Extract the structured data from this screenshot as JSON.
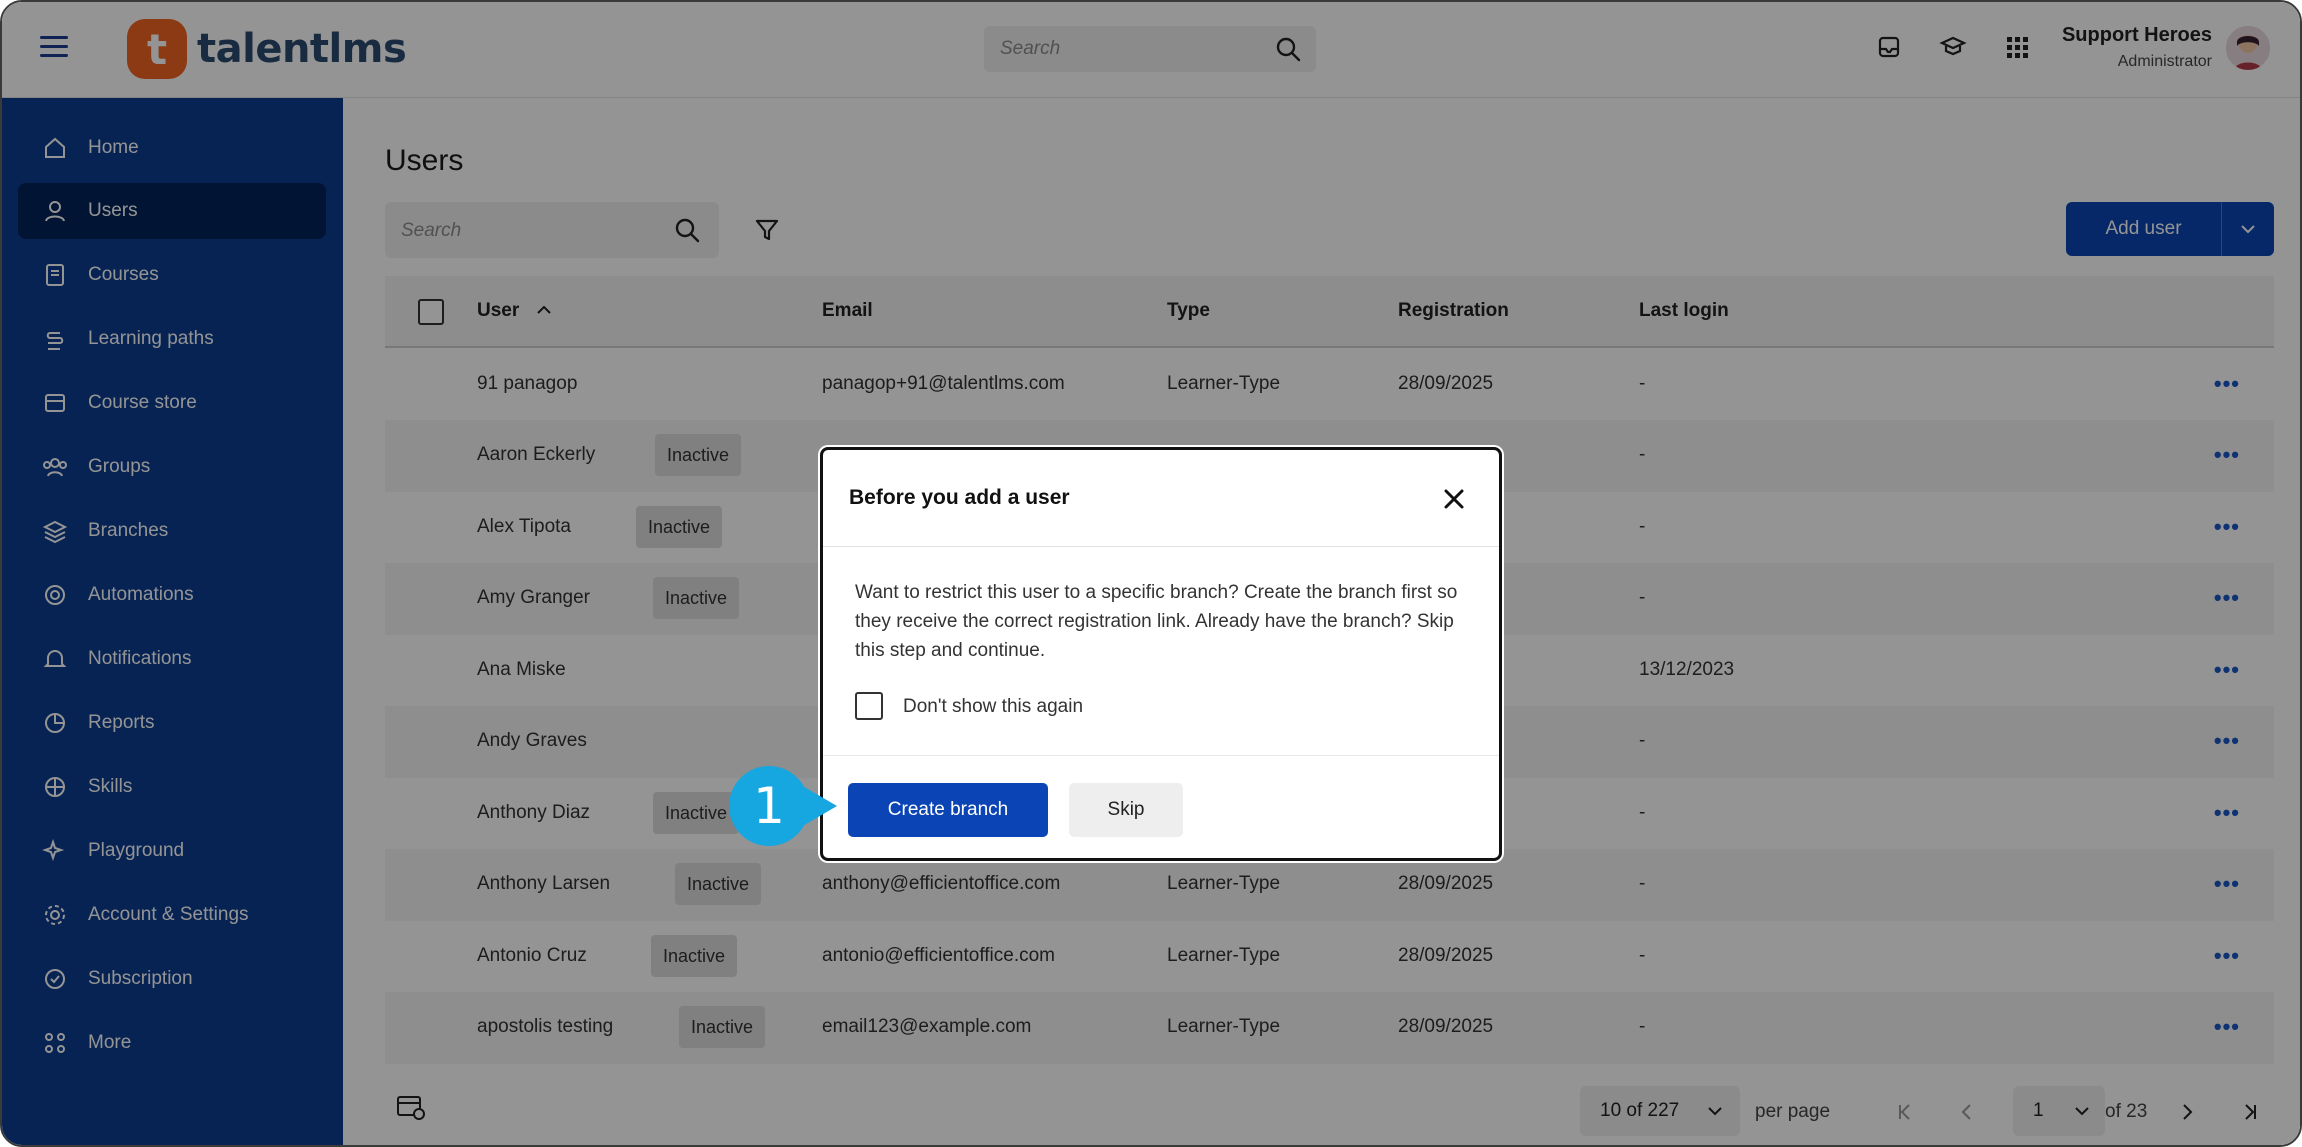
{
  "header": {
    "brand": "talentlms",
    "logo_glyph": "t",
    "search_placeholder": "Search",
    "profile_name": "Support Heroes",
    "profile_role": "Administrator"
  },
  "sidebar": {
    "items": [
      {
        "label": "Home",
        "icon": "home-icon"
      },
      {
        "label": "Users",
        "icon": "user-icon",
        "active": true
      },
      {
        "label": "Courses",
        "icon": "book-icon"
      },
      {
        "label": "Learning paths",
        "icon": "path-icon"
      },
      {
        "label": "Course store",
        "icon": "store-icon"
      },
      {
        "label": "Groups",
        "icon": "groups-icon"
      },
      {
        "label": "Branches",
        "icon": "layers-icon"
      },
      {
        "label": "Automations",
        "icon": "automation-icon"
      },
      {
        "label": "Notifications",
        "icon": "bell-icon"
      },
      {
        "label": "Reports",
        "icon": "pie-chart-icon"
      },
      {
        "label": "Skills",
        "icon": "skills-icon"
      },
      {
        "label": "Playground",
        "icon": "sparkle-icon"
      },
      {
        "label": "Account & Settings",
        "icon": "gear-icon"
      },
      {
        "label": "Subscription",
        "icon": "subscription-icon"
      },
      {
        "label": "More",
        "icon": "grid-icon"
      }
    ]
  },
  "main": {
    "title": "Users",
    "search_placeholder": "Search",
    "add_user_label": "Add user",
    "columns": [
      "User",
      "Email",
      "Type",
      "Registration",
      "Last login"
    ],
    "rows": [
      {
        "user": "91 panagop",
        "badge": "",
        "email": "panagop+91@talentlms.com",
        "type": "Learner-Type",
        "registration": "28/09/2025",
        "last_login": "-"
      },
      {
        "user": "Aaron Eckerly",
        "badge": "Inactive",
        "email": "",
        "type": "",
        "registration": "",
        "last_login": "-"
      },
      {
        "user": "Alex Tipota",
        "badge": "Inactive",
        "email": "",
        "type": "",
        "registration": "",
        "last_login": "-"
      },
      {
        "user": "Amy Granger",
        "badge": "Inactive",
        "email": "",
        "type": "",
        "registration": "",
        "last_login": "-"
      },
      {
        "user": "Ana Miske",
        "badge": "",
        "email": "",
        "type": "",
        "registration": "",
        "last_login": "13/12/2023"
      },
      {
        "user": "Andy Graves",
        "badge": "",
        "email": "",
        "type": "",
        "registration": "",
        "last_login": "-"
      },
      {
        "user": "Anthony Diaz",
        "badge": "Inactive",
        "email": "",
        "type": "",
        "registration": "",
        "last_login": "-"
      },
      {
        "user": "Anthony Larsen",
        "badge": "Inactive",
        "email": "anthony@efficientoffice.com",
        "type": "Learner-Type",
        "registration": "28/09/2025",
        "last_login": "-"
      },
      {
        "user": "Antonio Cruz",
        "badge": "Inactive",
        "email": "antonio@efficientoffice.com",
        "type": "Learner-Type",
        "registration": "28/09/2025",
        "last_login": "-"
      },
      {
        "user": "apostolis testing",
        "badge": "Inactive",
        "email": "email123@example.com",
        "type": "Learner-Type",
        "registration": "28/09/2025",
        "last_login": "-"
      }
    ],
    "pagination": {
      "range": "10 of 227",
      "per_page_label": "per page",
      "page": "1",
      "of_pages": "of 23"
    }
  },
  "modal": {
    "title": "Before you add a user",
    "body": "Want to restrict this user to a specific branch? Create the branch first so they receive the correct registration link. Already have the branch? Skip this step and continue.",
    "checkbox_label": "Don't show this again",
    "primary_button": "Create branch",
    "secondary_button": "Skip"
  },
  "callout": {
    "step_number": "1",
    "color": "#16a6e0"
  },
  "colors": {
    "brand_orange": "#f26522",
    "sidebar_blue": "#0b3d91",
    "primary_button": "#0b45b5"
  }
}
